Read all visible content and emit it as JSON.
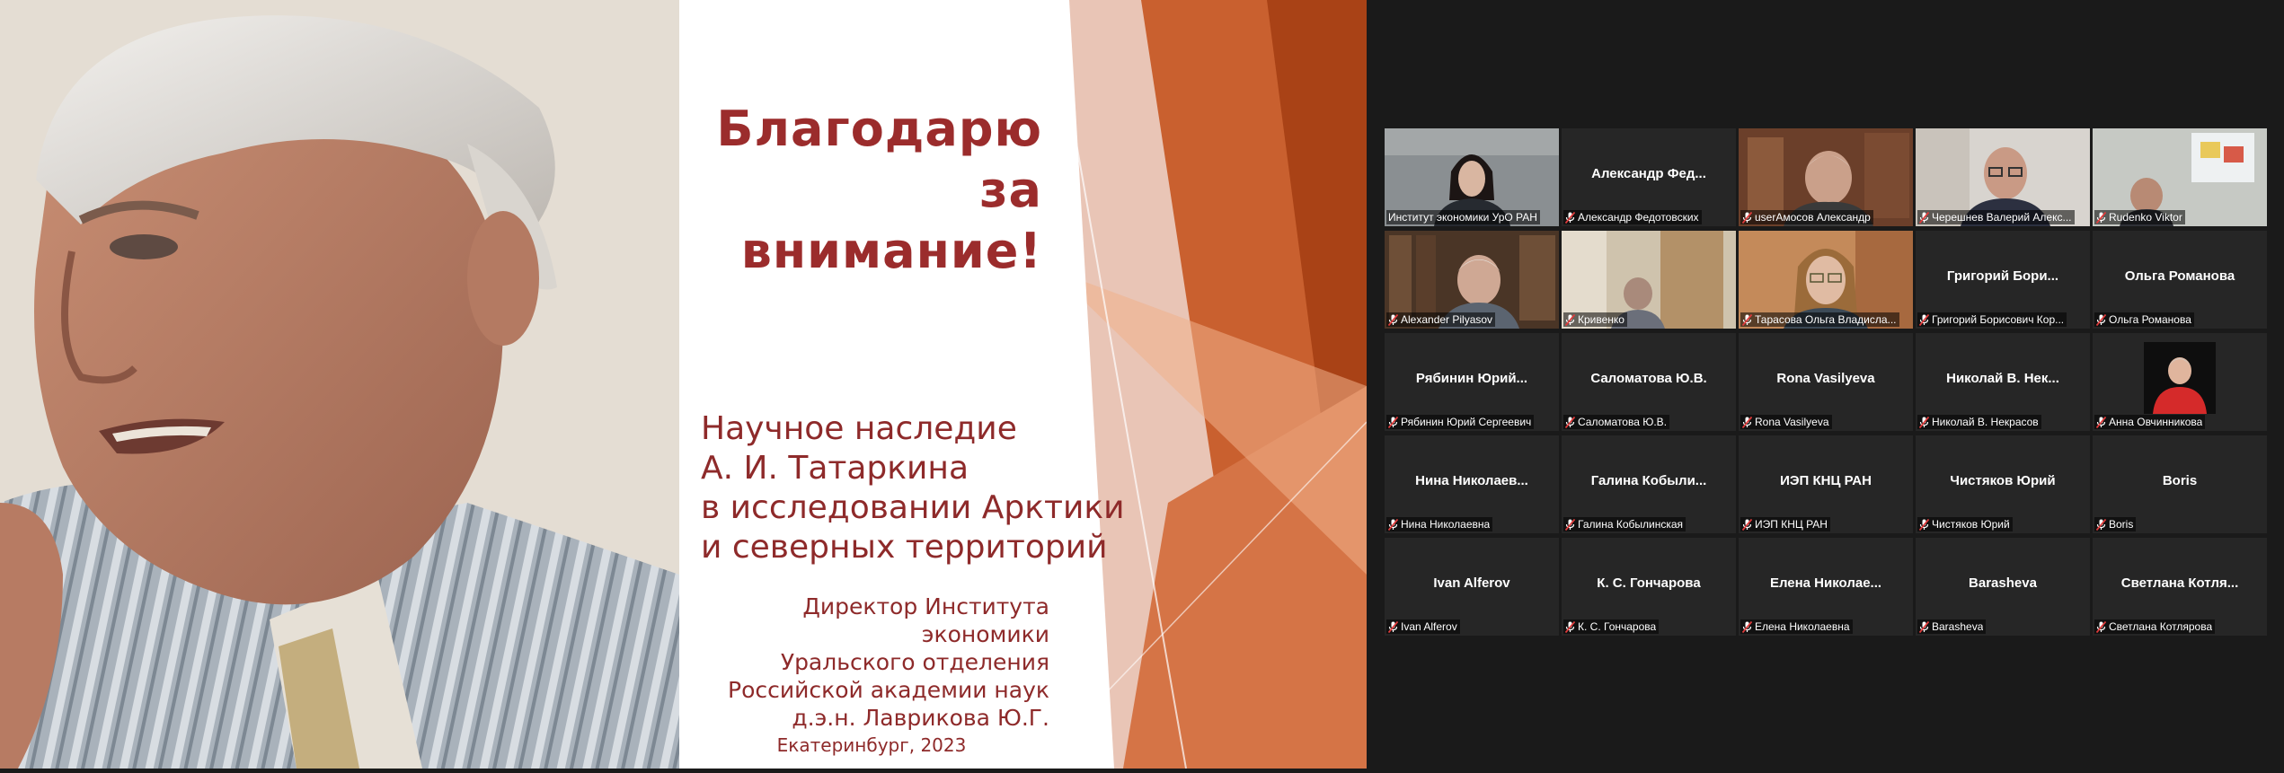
{
  "slide": {
    "title_line1": "Благодарю за",
    "title_line2": "внимание!",
    "subtitle_lines": [
      "Научное наследие",
      "А. И. Татаркина",
      "в исследовании Арктики",
      "и северных территорий"
    ],
    "author_lines": [
      "Директор Института экономики",
      "Уральского отделения",
      "Российской академии наук",
      "д.э.н. Лаврикова Ю.Г."
    ],
    "place_year": "Екатеринбург, 2023",
    "accent_color": "#9b2c2c"
  },
  "participants": [
    {
      "big": "",
      "label": "Институт экономики УрО РАН",
      "muted": false,
      "video": "woman-dark-hair"
    },
    {
      "big": "Александр Фед...",
      "label": "Александр Федотовских",
      "muted": true,
      "video": ""
    },
    {
      "big": "",
      "label": "userАмосов Александр",
      "muted": true,
      "video": "man-bookshelf"
    },
    {
      "big": "",
      "label": "Черешнев Валерий Алекс...",
      "muted": true,
      "video": "man-glasses-gray"
    },
    {
      "big": "",
      "label": "Rudenko Viktor",
      "muted": true,
      "video": "man-window"
    },
    {
      "big": "",
      "label": "Alexander Pilyasov",
      "muted": true,
      "video": "man-library"
    },
    {
      "big": "",
      "label": "Кривенко",
      "muted": true,
      "video": "room-door"
    },
    {
      "big": "",
      "label": "Тарасова Ольга Владисла...",
      "muted": true,
      "video": "woman-light-hair"
    },
    {
      "big": "Григорий Бори...",
      "label": "Григорий Борисович Кор...",
      "muted": true,
      "video": ""
    },
    {
      "big": "Ольга Романова",
      "label": "Ольга Романова",
      "muted": true,
      "video": ""
    },
    {
      "big": "Рябинин Юрий...",
      "label": "Рябинин Юрий Сергеевич",
      "muted": true,
      "video": ""
    },
    {
      "big": "Саломатова Ю.В.",
      "label": "Саломатова Ю.В.",
      "muted": true,
      "video": ""
    },
    {
      "big": "Rona Vasilyeva",
      "label": "Rona Vasilyeva",
      "muted": true,
      "video": ""
    },
    {
      "big": "Николай В. Нек...",
      "label": "Николай В. Некрасов",
      "muted": true,
      "video": ""
    },
    {
      "big": "",
      "label": "Анна Овчинникова",
      "muted": true,
      "video": "avatar-red"
    },
    {
      "big": "Нина Николаев...",
      "label": "Нина Николаевна",
      "muted": true,
      "video": ""
    },
    {
      "big": "Галина Кобыли...",
      "label": "Галина Кобылинская",
      "muted": true,
      "video": ""
    },
    {
      "big": "ИЭП КНЦ РАН",
      "label": "ИЭП КНЦ РАН",
      "muted": true,
      "video": ""
    },
    {
      "big": "Чистяков Юрий",
      "label": "Чистяков Юрий",
      "muted": true,
      "video": ""
    },
    {
      "big": "Boris",
      "label": "Boris",
      "muted": true,
      "video": ""
    },
    {
      "big": "Ivan Alferov",
      "label": "Ivan Alferov",
      "muted": true,
      "video": ""
    },
    {
      "big": "К. С. Гончарова",
      "label": "К. С. Гончарова",
      "muted": true,
      "video": ""
    },
    {
      "big": "Елена Николае...",
      "label": "Елена Николаевна",
      "muted": true,
      "video": ""
    },
    {
      "big": "Barasheva",
      "label": "Barasheva",
      "muted": true,
      "video": ""
    },
    {
      "big": "Светлана Котля...",
      "label": "Светлана Котлярова",
      "muted": true,
      "video": ""
    }
  ],
  "colors": {
    "active_speaker": "#c7e05a",
    "muted_icon": "#e03c3c",
    "tile_bg": "#262626"
  }
}
